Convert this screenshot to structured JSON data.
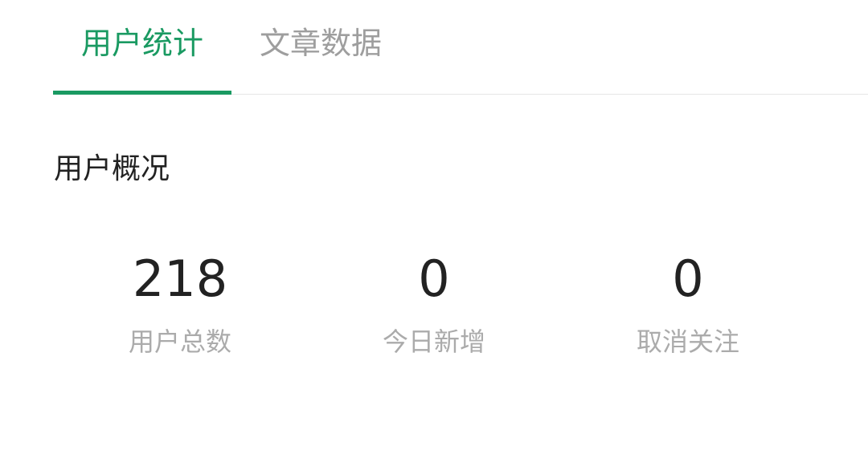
{
  "tabs": {
    "items": [
      {
        "label": "用户统计",
        "active": true
      },
      {
        "label": "文章数据",
        "active": false
      }
    ],
    "active_color": "#1a9a62",
    "inactive_color": "#9e9e9e"
  },
  "overview": {
    "title": "用户概况",
    "stats": [
      {
        "value": "218",
        "label": "用户总数"
      },
      {
        "value": "0",
        "label": "今日新增"
      },
      {
        "value": "0",
        "label": "取消关注"
      }
    ]
  }
}
